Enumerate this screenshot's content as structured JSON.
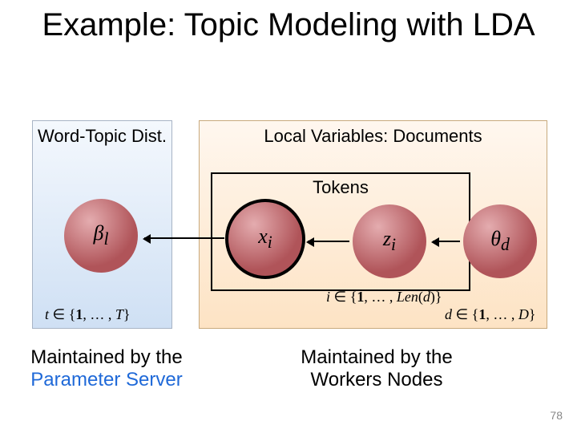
{
  "title": "Example: Topic Modeling with LDA",
  "left_box": {
    "title": "Word-Topic Dist."
  },
  "right_box": {
    "title": "Local Variables: Documents",
    "inner_label": "Tokens"
  },
  "nodes": {
    "beta": "βₗ",
    "xi": "xᵢ",
    "zi": "zᵢ",
    "theta": "θ_d"
  },
  "math": {
    "t_range": "t ∈ {1, …, T}",
    "i_range": "i ∈ {1, …, Len(d)}",
    "d_range": "d ∈ {1, …, D}"
  },
  "captions": {
    "left_line1": "Maintained by the",
    "left_line2": "Parameter Server",
    "right_line1": "Maintained by the",
    "right_line2": "Workers Nodes"
  },
  "page_number": "78"
}
